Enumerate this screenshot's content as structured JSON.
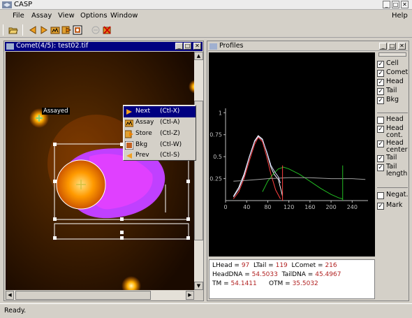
{
  "app": {
    "title": "CASP"
  },
  "menubar": {
    "file": "File",
    "assay": "Assay",
    "view": "View",
    "options": "Options",
    "window": "Window",
    "help": "Help"
  },
  "comet_window": {
    "title": "Comet(4/5): test02.tif",
    "assayed_label": "Assayed",
    "context_menu": [
      {
        "label": "Next",
        "shortcut": "(Ctl-X)",
        "icon": "next-arrow-icon"
      },
      {
        "label": "Assay",
        "shortcut": "(Ctl-A)",
        "icon": "assay-icon"
      },
      {
        "label": "Store",
        "shortcut": "(Ctl-Z)",
        "icon": "store-icon"
      },
      {
        "label": "Bkg",
        "shortcut": "(Ctl-W)",
        "icon": "bkg-icon"
      },
      {
        "label": "Prev",
        "shortcut": "(Ctl-S)",
        "icon": "prev-arrow-icon"
      }
    ]
  },
  "profiles_window": {
    "title": "Profiles",
    "checkboxes_top": [
      {
        "label": "Cell",
        "checked": true
      },
      {
        "label": "Comet",
        "checked": true
      },
      {
        "label": "Head",
        "checked": true
      },
      {
        "label": "Tail",
        "checked": true
      },
      {
        "label": "Bkg",
        "checked": true
      }
    ],
    "checkboxes_mid": [
      {
        "label": "Head",
        "checked": false
      },
      {
        "label": "Head cont.",
        "checked": true
      },
      {
        "label": "Head center",
        "checked": true
      },
      {
        "label": "Tail",
        "checked": true
      },
      {
        "label": "Tail length",
        "checked": true
      }
    ],
    "checkboxes_bottom": [
      {
        "label": "Negat.",
        "checked": false
      },
      {
        "label": "Mark",
        "checked": true
      }
    ],
    "stats": {
      "lhead_label": "LHead =",
      "lhead": "97",
      "ltail_label": "LTail =",
      "ltail": "119",
      "lcomet_label": "LComet =",
      "lcomet": "216",
      "headdna_label": "HeadDNA =",
      "headdna": "54.5033",
      "taildna_label": "TailDNA =",
      "taildna": "45.4967",
      "tm_label": "TM =",
      "tm": "54.1411",
      "otm_label": "OTM =",
      "otm": "35.5032"
    }
  },
  "chart_data": {
    "type": "line",
    "x_ticks": [
      "0",
      "40",
      "80",
      "120",
      "160",
      "200",
      "240"
    ],
    "y_ticks": [
      "0.25",
      "0.5",
      "0.75",
      "1"
    ],
    "xlim": [
      0,
      270
    ],
    "ylim": [
      0,
      1.05
    ],
    "series": [
      {
        "color": "#ffffff",
        "points": [
          [
            15,
            0.05
          ],
          [
            25,
            0.15
          ],
          [
            35,
            0.3
          ],
          [
            45,
            0.5
          ],
          [
            55,
            0.68
          ],
          [
            62,
            0.74
          ],
          [
            70,
            0.7
          ],
          [
            78,
            0.55
          ],
          [
            86,
            0.38
          ],
          [
            92,
            0.3
          ],
          [
            100,
            0.24
          ],
          [
            106,
            0.1
          ],
          [
            108,
            0.05
          ]
        ]
      },
      {
        "color": "#ff4040",
        "points": [
          [
            15,
            0.02
          ],
          [
            25,
            0.1
          ],
          [
            35,
            0.25
          ],
          [
            45,
            0.45
          ],
          [
            55,
            0.64
          ],
          [
            62,
            0.72
          ],
          [
            70,
            0.67
          ],
          [
            78,
            0.5
          ],
          [
            86,
            0.3
          ],
          [
            95,
            0.12
          ],
          [
            104,
            0.02
          ]
        ]
      },
      {
        "color": "#22bb22",
        "points": [
          [
            70,
            0.1
          ],
          [
            80,
            0.22
          ],
          [
            90,
            0.3
          ],
          [
            100,
            0.36
          ],
          [
            110,
            0.38
          ],
          [
            120,
            0.36
          ],
          [
            140,
            0.3
          ],
          [
            160,
            0.22
          ],
          [
            180,
            0.14
          ],
          [
            200,
            0.07
          ],
          [
            215,
            0.03
          ],
          [
            222,
            0.02
          ]
        ]
      },
      {
        "color": "#a0a0a0",
        "points": [
          [
            15,
            0.22
          ],
          [
            40,
            0.23
          ],
          [
            80,
            0.25
          ],
          [
            120,
            0.26
          ],
          [
            160,
            0.26
          ],
          [
            200,
            0.25
          ],
          [
            240,
            0.25
          ],
          [
            265,
            0.24
          ]
        ]
      },
      {
        "color": "#d8d8ff",
        "points": [
          [
            15,
            0.04
          ],
          [
            25,
            0.13
          ],
          [
            35,
            0.28
          ],
          [
            45,
            0.49
          ],
          [
            55,
            0.67
          ],
          [
            62,
            0.73
          ],
          [
            70,
            0.69
          ],
          [
            78,
            0.56
          ],
          [
            86,
            0.4
          ],
          [
            94,
            0.32
          ],
          [
            100,
            0.27
          ],
          [
            104,
            0.2
          ]
        ]
      }
    ],
    "vlines": [
      {
        "x": 108,
        "color": "#ff4040"
      },
      {
        "x": 222,
        "color": "#22bb22"
      }
    ]
  },
  "statusbar": {
    "text": "Ready."
  }
}
